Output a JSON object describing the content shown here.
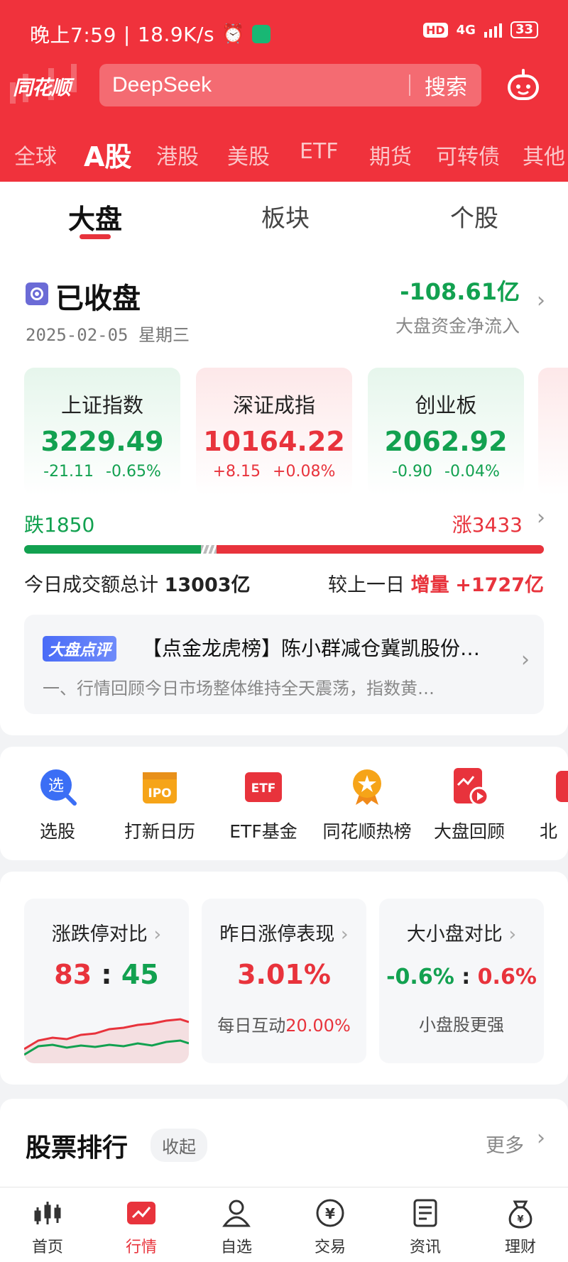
{
  "status_bar": {
    "time": "晚上7:59",
    "speed": "18.9K/s",
    "hd": "HD",
    "network": "4G",
    "battery": "33"
  },
  "header": {
    "logo": "同花顺",
    "search": {
      "value": "DeepSeek",
      "button": "搜索"
    },
    "market_tabs": [
      "全球",
      "A股",
      "港股",
      "美股",
      "ETF",
      "期货",
      "可转债",
      "其他"
    ],
    "active_market_tab": "A股"
  },
  "sub_tabs": [
    "大盘",
    "板块",
    "个股"
  ],
  "summary": {
    "status": "已收盘",
    "date": "2025-02-05 星期三",
    "net_inflow": "-108.61亿",
    "net_inflow_label": "大盘资金净流入"
  },
  "indices": [
    {
      "name": "上证指数",
      "value": "3229.49",
      "change": "-21.11",
      "pct": "-0.65%"
    },
    {
      "name": "深证成指",
      "value": "10164.22",
      "change": "+8.15",
      "pct": "+0.08%"
    },
    {
      "name": "创业板",
      "value": "2062.92",
      "change": "-0.90",
      "pct": "-0.04%"
    }
  ],
  "breadth": {
    "fall_label": "跌",
    "fall": "1850",
    "rise_label": "涨",
    "rise": "3433",
    "fall_count": 1850,
    "rise_count": 3433
  },
  "turnover": {
    "label": "今日成交额总计",
    "value": "13003亿",
    "compare_label": "较上一日",
    "compare_tag": "增量",
    "compare_value": "+1727亿"
  },
  "review": {
    "badge": "大盘点评",
    "title": "【点金龙虎榜】陈小群减仓冀凯股份…",
    "desc": "一、行情回顾今日市场整体维持全天震荡，指数黄…"
  },
  "tools": [
    {
      "label": "选股",
      "icon": "magnifier-select-icon"
    },
    {
      "label": "打新日历",
      "icon": "ipo-calendar-icon"
    },
    {
      "label": "ETF基金",
      "icon": "etf-icon"
    },
    {
      "label": "同花顺热榜",
      "icon": "hot-rank-medal-icon"
    },
    {
      "label": "大盘回顾",
      "icon": "market-review-play-icon"
    },
    {
      "label": "北",
      "icon": "partial-icon"
    }
  ],
  "stats": {
    "limit": {
      "title": "涨跌停对比",
      "up": "83",
      "sep": ":",
      "down": "45"
    },
    "yesterday": {
      "title": "昨日涨停表现",
      "value": "3.01%",
      "note_label": "每日互动",
      "note_value": "20.00%"
    },
    "size": {
      "title": "大小盘对比",
      "big": "-0.6%",
      "sep": ":",
      "small": "0.6%",
      "note": "小盘股更强"
    }
  },
  "ranking": {
    "title": "股票排行",
    "collapse": "收起",
    "more": "更多"
  },
  "bottom_nav": [
    {
      "label": "首页",
      "icon": "home-candles-icon"
    },
    {
      "label": "行情",
      "icon": "market-chart-icon"
    },
    {
      "label": "自选",
      "icon": "watchlist-person-icon"
    },
    {
      "label": "交易",
      "icon": "trade-yuan-icon"
    },
    {
      "label": "资讯",
      "icon": "news-doc-icon"
    },
    {
      "label": "理财",
      "icon": "wealth-bag-icon"
    }
  ],
  "colors": {
    "brand": "#f0323c",
    "rise": "#e8333c",
    "fall": "#12a150"
  }
}
